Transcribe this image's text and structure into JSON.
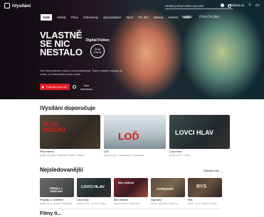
{
  "app": {
    "logo_text": "iVysílání"
  },
  "search": {
    "placeholder": "Hledat pořad nebo epizodu"
  },
  "topbar": {
    "login": "Přihlásit se",
    "lang": "ČT"
  },
  "nav": {
    "items": [
      "Vodě",
      "Seriály",
      "Filmy",
      "Dokumenty",
      "Zpravodajství",
      "Sport",
      "Pro děti",
      "Zábava",
      "Historie",
      "Další"
    ],
    "right": [
      "Vysílání",
      "ČT24 ČT1 živě"
    ]
  },
  "hero": {
    "title_line1": "VLASTNĚ",
    "title_line2": "SE NIC",
    "title_line3": "NESTALO",
    "badge_title": "Digital Fiction",
    "badge_seal": "PRIX ITALIA",
    "description": "Dvě ženy jednoho muže a nová zkušenost. Žaře a ostatní vstupují do světa, co neformálně dovolí zdrah.",
    "play_label": "Přehrát první díl",
    "info_label": "Více informací"
  },
  "sections": {
    "recommended": {
      "title": "iVysílání doporučuje",
      "cards": [
        {
          "thumb_text": "PLUK MIZERŮ",
          "title": "Pluk mizerů",
          "meta": "Seriál • Komedie • Historické • Drama • Válečné"
        },
        {
          "thumb_text": "LOĎ",
          "title": "Loď",
          "meta": "Dokumentární • Technologie • Architektura"
        },
        {
          "thumb_text": "LOVCI HLAV",
          "title": "Lovci hlav",
          "meta": "Seriál • Krimi • Thriller"
        }
      ]
    },
    "most_watched": {
      "title": "Nejsledovanější",
      "more_label": "Zobrazit více",
      "cards": [
        {
          "thumb_text": "PŘÍPADY 1. ODDĚLENÍ",
          "title": "Případy 1. oddělení",
          "meta": "Seriál • Krimi • Drama • Detektivka"
        },
        {
          "thumb_text": "LOVCI HLAV",
          "title": "Lovci hlav",
          "meta": "Seriál • Krimi • Drama • Thriller"
        },
        {
          "thumb_text": "Bez vědomí",
          "title": "Bez vědomí",
          "meta": "Seriál • Drama • Mysteriózní"
        },
        {
          "thumb_text": "VYPRAVĚČ",
          "title": "Vyprávěj",
          "meta": "Seriál • Historické • Rodinné"
        },
        {
          "thumb_text": "RYS",
          "title": "Rys",
          "meta": "Seriál • Krimi • Drama • Thriller"
        }
      ]
    },
    "next": {
      "title": "Filmy ti..."
    }
  },
  "colors": {
    "accent": "#e11b22"
  }
}
